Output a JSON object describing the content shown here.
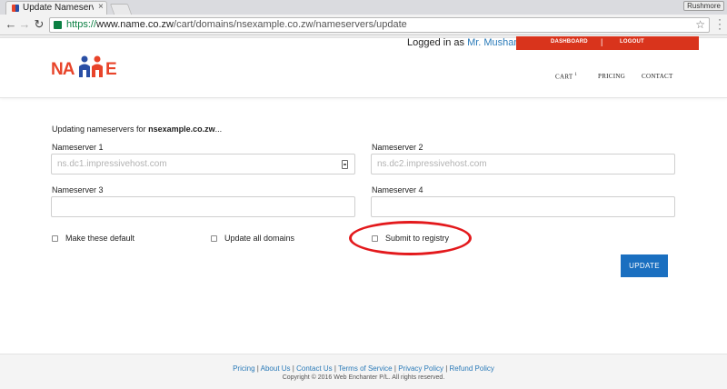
{
  "browser": {
    "tab_title": "Update Nameservers",
    "tab_close": "×",
    "profile_label": "Rushmore",
    "url_scheme": "https://",
    "url_host": "www.name.co.zw",
    "url_path": "/cart/domains/nsexample.co.zw/nameservers/update",
    "back_glyph": "←",
    "forward_glyph": "→",
    "reload_glyph": "↻",
    "star_glyph": "☆"
  },
  "header": {
    "logged_in_prefix": "Logged in as",
    "user_name": "Mr. Mushambi",
    "dashboard_label": "DASHBOARD",
    "separator": "|",
    "logout_label": "LOGOUT",
    "logo_left": "NA",
    "logo_right": "E",
    "nav": {
      "cart_label": "CART",
      "cart_count": "1",
      "pricing_label": "PRICING",
      "contact_label": "CONTACT"
    },
    "brand_colors": {
      "red": "#e8442a",
      "blue": "#2a4fa5"
    }
  },
  "main": {
    "updating_prefix": "Updating nameservers for",
    "domain": "nsexample.co.zw",
    "updating_suffix": "...",
    "ns1": {
      "label": "Nameserver 1",
      "placeholder": "ns.dc1.impressivehost.com",
      "value": ""
    },
    "ns2": {
      "label": "Nameserver 2",
      "placeholder": "ns.dc2.impressivehost.com",
      "value": ""
    },
    "ns3": {
      "label": "Nameserver 3",
      "placeholder": "",
      "value": ""
    },
    "ns4": {
      "label": "Nameserver 4",
      "placeholder": "",
      "value": ""
    },
    "options": {
      "make_default": {
        "label": "Make these default",
        "checked": false
      },
      "update_all": {
        "label": "Update all domains",
        "checked": false
      },
      "submit_registry": {
        "label": "Submit to registry",
        "checked": false
      }
    },
    "update_button": "UPDATE",
    "accent_color": "#1a6fc0",
    "annotation_color": "#e3191c"
  },
  "footer": {
    "links": [
      "Pricing",
      "About Us",
      "Contact Us",
      "Terms of Service",
      "Privacy Policy",
      "Refund Policy"
    ],
    "separator": "|",
    "copyright": "Copyright © 2016 Web Enchanter P/L. All rights reserved."
  }
}
